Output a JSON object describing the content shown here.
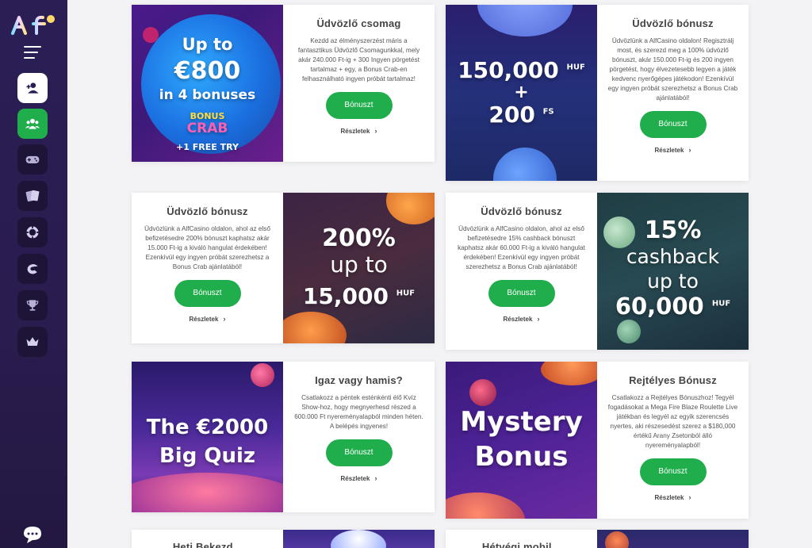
{
  "sidebar": {
    "logo_text": "Alf",
    "nav": [
      {
        "icon": "user-add-icon"
      },
      {
        "icon": "users-icon"
      },
      {
        "icon": "gamepad-icon"
      },
      {
        "icon": "cards-icon"
      },
      {
        "icon": "chip-icon"
      },
      {
        "icon": "crab-icon"
      },
      {
        "icon": "trophy-icon"
      },
      {
        "icon": "crown-icon"
      }
    ]
  },
  "cards": [
    {
      "title": "Üdvözlő csomag",
      "desc": "Kezdd az élményszerzést máris a fantasztikus Üdvözlő Csomagunkkal, mely akár 240.000 Ft-ig + 300 Ingyen pörgetést tartalmaz + egy, a Bonus Crab-en felhasználható ingyen próbát tartalmaz!",
      "button": "Bónuszt",
      "details": "Részletek",
      "img": {
        "line1": "Up to",
        "line2": "€800",
        "line3": "in 4 bonuses",
        "crab1": "BONUS",
        "crab2": "CRAB",
        "extra": "+1 FREE TRY"
      }
    },
    {
      "title": "Üdvözlő bónusz",
      "desc": "Üdvözlünk a AlfCasino oldalon! Regisztrálj most, és szerezd meg a 100% üdvözlő bónuszt, akár 150.000 Ft-ig és 200 ingyen pörgetést, hogy élvezetesebb legyen a játék kedvenc nyerőgépes játékodon! Ezenkívül egy ingyen próbát szerezhetsz a Bonus Crab ajánlatából!",
      "button": "Bónuszt",
      "details": "Részletek",
      "img": {
        "line1": "150,000",
        "cur": "HUF",
        "plus": "+",
        "line2": "200",
        "fs": "FS"
      }
    },
    {
      "title": "Üdvözlő bónusz",
      "desc": "Üdvözlünk a AlfCasino oldalon, ahol az első befizetésedre 200% bónuszt kaphatsz akár 15.000 Ft-ig a kiváló hangulat érdekében! Ezenkívül egy ingyen próbát szerezhetsz a Bonus Crab ajánlatából!",
      "button": "Bónuszt",
      "details": "Részletek",
      "img": {
        "line1": "200%",
        "line2": "up to",
        "line3": "15,000",
        "cur": "HUF"
      }
    },
    {
      "title": "Üdvözlő bónusz",
      "desc": "Üdvözlünk a AlfCasino oldalon, ahol az első befizetésedre 15% cashback bónuszt kaphatsz akár 60.000 Ft-ig a kiváló hangulat érdekében! Ezenkívül egy ingyen próbát szerezhetsz a Bonus Crab ajánlatából!",
      "button": "Bónuszt",
      "details": "Részletek",
      "img": {
        "line1": "15%",
        "line2": "cashback",
        "line3": "up to",
        "line4": "60,000",
        "cur": "HUF"
      }
    },
    {
      "title": "Igaz vagy hamis?",
      "desc": "Csatlakozz a péntek esténkénti élő Kvíz Show-hoz, hogy megnyerhesd részed a 600.000 Ft nyereményalapból minden héten. A belépés ingyenes!",
      "button": "Bónuszt",
      "details": "Részletek",
      "img": {
        "line1": "The €2000",
        "line2": "Big Quiz"
      }
    },
    {
      "title": "Rejtélyes Bónusz",
      "desc": "Csatlakozz a Rejtélyes Bónuszhoz! Tegyél fogadásokat a Mega Fire Blaze Roulette Live játékban és legyél az egyik szerencsés nyertes, aki részesedést szerez a $180,000 értékű Arany Zsetonból álló nyereményalapból!",
      "button": "Bónuszt",
      "details": "Részletek",
      "img": {
        "line1": "Mystery",
        "line2": "Bonus"
      }
    }
  ],
  "partial": {
    "left_title": "Heti Bekezd...",
    "right_title": "Hétvégi mobil..."
  }
}
